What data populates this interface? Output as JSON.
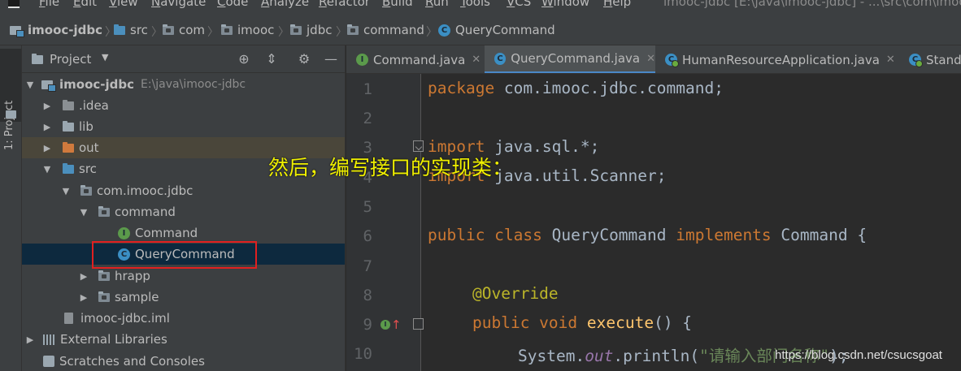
{
  "menubar": {
    "items": [
      "File",
      "Edit",
      "View",
      "Navigate",
      "Code",
      "Analyze",
      "Refactor",
      "Build",
      "Run",
      "Tools",
      "VCS",
      "Window",
      "Help"
    ],
    "window_title": "imooc-jdbc [E:\\java\\imooc-jdbc] - ...\\src\\com\\imooc"
  },
  "breadcrumb": [
    "imooc-jdbc",
    "src",
    "com",
    "imooc",
    "jdbc",
    "command",
    "QueryCommand"
  ],
  "toolstrip": {
    "label": "1: Project"
  },
  "project_panel": {
    "title": "Project",
    "tree": [
      {
        "label": "imooc-jdbc",
        "path": "E:\\java\\imooc-jdbc"
      },
      {
        "label": ".idea"
      },
      {
        "label": "lib"
      },
      {
        "label": "out"
      },
      {
        "label": "src"
      },
      {
        "label": "com.imooc.jdbc"
      },
      {
        "label": "command"
      },
      {
        "label": "Command",
        "icon": "I"
      },
      {
        "label": "QueryCommand",
        "icon": "C"
      },
      {
        "label": "hrapp"
      },
      {
        "label": "sample"
      },
      {
        "label": "imooc-jdbc.iml"
      },
      {
        "label": "External Libraries"
      },
      {
        "label": "Scratches and Consoles"
      }
    ]
  },
  "editor_tabs": [
    {
      "label": "Command.java",
      "active": false
    },
    {
      "label": "QueryCommand.java",
      "active": true
    },
    {
      "label": "HumanResourceApplication.java",
      "active": false
    },
    {
      "label": "Stand",
      "active": false
    }
  ],
  "editor": {
    "line_numbers": [
      "1",
      "2",
      "3",
      "4",
      "5",
      "6",
      "7",
      "8",
      "9",
      "10"
    ],
    "code": {
      "l1_kw": "package",
      "l1_rest": " com.imooc.jdbc.command;",
      "l3_kw": "import",
      "l3_rest": " java.sql.*;",
      "l4_kw": "import",
      "l4_rest": " java.util.Scanner;",
      "l6_kw1": "public class",
      "l6_name": " QueryCommand ",
      "l6_kw2": "implements",
      "l6_rest": " Command {",
      "l8_ann": "@Override",
      "l9_kw": "public void",
      "l9_fn": "execute",
      "l9_rest": "() {",
      "l10_pre": "System.",
      "l10_field": "out",
      "l10_mid": ".println(",
      "l10_str": "\"请输入部门名称\"",
      "l10_end": ");"
    }
  },
  "overlay": {
    "subtitle": "然后，编写接口的实现类：",
    "watermark": "https://blog.csdn.net/csucsgoat"
  },
  "icons": [
    "project-folder-icon",
    "module-icon",
    "folder-icon",
    "package-icon",
    "class-icon",
    "interface-icon",
    "close-icon",
    "settings-gear-icon",
    "locate-icon",
    "collapse-icon",
    "minimize-icon",
    "override-gutter-icon"
  ]
}
